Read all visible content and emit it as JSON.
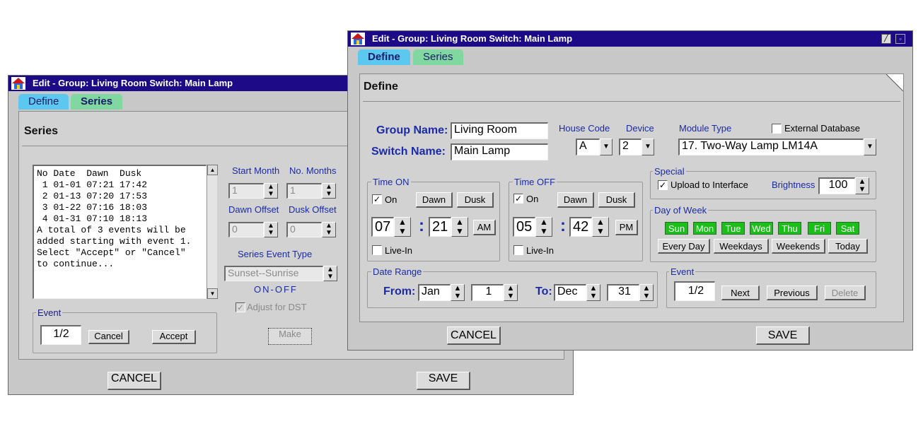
{
  "back_window": {
    "title": "Edit - Group: Living Room  Switch: Main Lamp",
    "tabs": [
      "Define",
      "Series"
    ],
    "panel_title": "Series",
    "list_lines": [
      "No Date  Dawn  Dusk",
      " 1 01-01 07:21 17:42",
      " 2 01-13 07:20 17:53",
      " 3 01-22 07:16 18:03",
      " 4 01-31 07:10 18:13",
      "A total of 3 events will be",
      "added starting with event 1.",
      "Select \"Accept\" or \"Cancel\"",
      "to continue..."
    ],
    "start_month_label": "Start Month",
    "start_month_value": "1",
    "no_months_label": "No. Months",
    "no_months_value": "1",
    "dawn_offset_label": "Dawn Offset",
    "dawn_offset_value": "0",
    "dusk_offset_label": "Dusk Offset",
    "dusk_offset_value": "0",
    "series_event_type_label": "Series Event Type",
    "series_event_type_value": "Sunset--Sunrise",
    "on_off_label": "ON-OFF",
    "adjust_dst_label": "Adjust for DST",
    "event_group_label": "Event",
    "event_value": "1/2",
    "cancel_small": "Cancel",
    "accept": "Accept",
    "make": "Make",
    "cancel": "CANCEL",
    "save": "SAVE"
  },
  "front_window": {
    "title": "Edit - Group: Living Room  Switch: Main Lamp",
    "tabs": [
      "Define",
      "Series"
    ],
    "panel_title": "Define",
    "group_name_label": "Group Name:",
    "group_name_value": "Living Room",
    "switch_name_label": "Switch Name:",
    "switch_name_value": "Main Lamp",
    "house_code_label": "House Code",
    "house_code_value": "A",
    "device_label": "Device",
    "device_value": "2",
    "module_type_label": "Module Type",
    "module_type_value": "17. Two-Way Lamp   LM14A",
    "external_db_label": "External Database",
    "time_on": {
      "label": "Time ON",
      "on_label": "On",
      "dawn": "Dawn",
      "dusk": "Dusk",
      "hour": "07",
      "minute": "21",
      "ampm": "AM",
      "live_in": "Live-In",
      "colon": ":"
    },
    "time_off": {
      "label": "Time OFF",
      "on_label": "On",
      "dawn": "Dawn",
      "dusk": "Dusk",
      "hour": "05",
      "minute": "42",
      "ampm": "PM",
      "live_in": "Live-In",
      "colon": ":"
    },
    "special_label": "Special",
    "upload_label": "Upload to Interface",
    "brightness_label": "Brightness",
    "brightness_value": "100",
    "day_of_week_label": "Day of Week",
    "days": [
      "Sun",
      "Mon",
      "Tue",
      "Wed",
      "Thu",
      "Fri",
      "Sat"
    ],
    "every_day": "Every Day",
    "weekdays": "Weekdays",
    "weekends": "Weekends",
    "today": "Today",
    "date_range_label": "Date Range",
    "from_label": "From:",
    "from_month": "Jan",
    "from_day": "1",
    "to_label": "To:",
    "to_month": "Dec",
    "to_day": "31",
    "event_label": "Event",
    "event_value": "1/2",
    "next": "Next",
    "previous": "Previous",
    "delete": "Delete",
    "cancel": "CANCEL",
    "save": "SAVE"
  },
  "colors": {
    "titlebar": "#1c0a86",
    "day_green": "#18c018",
    "tab_blue": "#5cc8f0",
    "tab_green": "#80d8a0",
    "label_blue": "#1b2aa8"
  }
}
